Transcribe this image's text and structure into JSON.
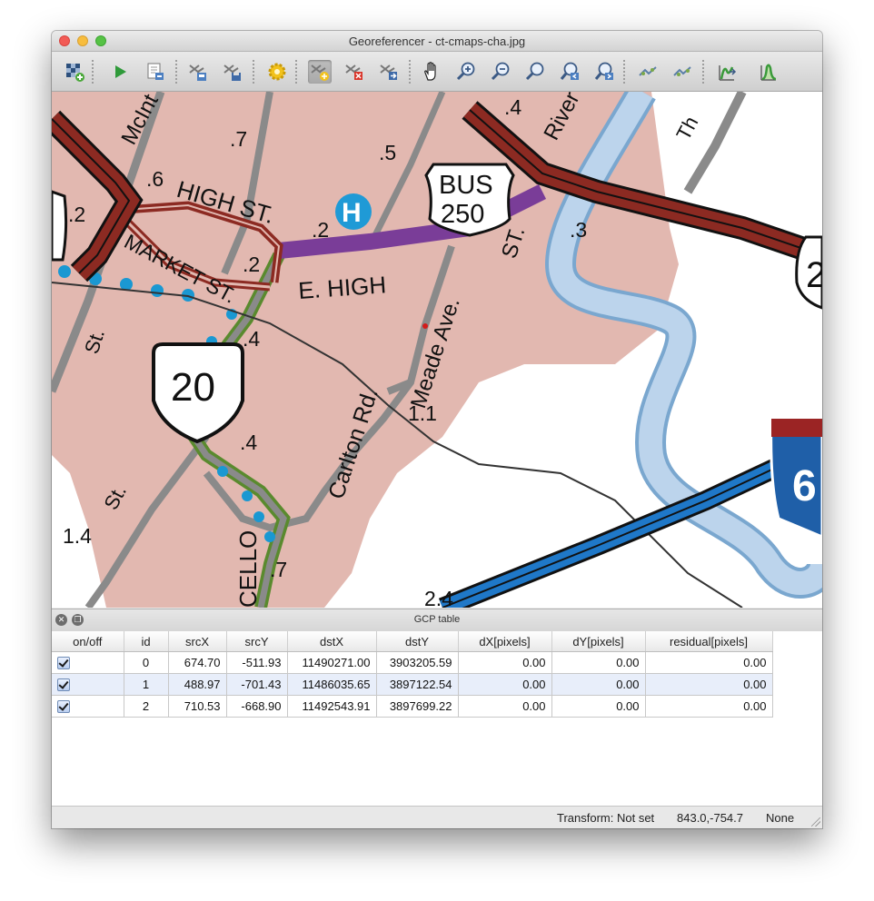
{
  "window": {
    "title": "Georeferencer - ct-cmaps-cha.jpg"
  },
  "toolbar": {
    "buttons": [
      {
        "icon": "open-raster-icon",
        "label": "Open raster"
      },
      {
        "icon": "start-georeferencing-icon",
        "label": "Start georeferencing"
      },
      {
        "icon": "generate-gdal-script-icon",
        "label": "Generate GDAL script"
      },
      {
        "icon": "load-gcp-points-icon",
        "label": "Load GCP points"
      },
      {
        "icon": "save-gcp-points-icon",
        "label": "Save GCP points"
      },
      {
        "icon": "transformation-settings-icon",
        "label": "Transformation settings"
      },
      {
        "icon": "add-point-icon",
        "label": "Add point"
      },
      {
        "icon": "delete-point-icon",
        "label": "Delete point"
      },
      {
        "icon": "move-gcp-point-icon",
        "label": "Move GCP point"
      },
      {
        "icon": "pan-icon",
        "label": "Pan"
      },
      {
        "icon": "zoom-in-icon",
        "label": "Zoom in"
      },
      {
        "icon": "zoom-out-icon",
        "label": "Zoom out"
      },
      {
        "icon": "zoom-to-layer-icon",
        "label": "Zoom to layer"
      },
      {
        "icon": "zoom-last-icon",
        "label": "Zoom last"
      },
      {
        "icon": "zoom-next-icon",
        "label": "Zoom next"
      },
      {
        "icon": "link-georeferencer-to-qgis-icon",
        "label": "Link georeferencer to QGIS"
      },
      {
        "icon": "link-qgis-to-georeferencer-icon",
        "label": "Link QGIS to georeferencer"
      },
      {
        "icon": "full-histogram-stretch-icon",
        "label": "Full histogram stretch"
      },
      {
        "icon": "local-histogram-stretch-icon",
        "label": "Local histogram stretch"
      }
    ]
  },
  "map": {
    "labels": {
      "high_st_top": "HIGH ST.",
      "market_st": "MARKET ST.",
      "e_high": "E.   HIGH",
      "meade_ave": "Meade Ave.",
      "carlton_rd": "Carlton Rd.",
      "river": "River",
      "mcint": "McInt",
      "st_left": "St.",
      "st_lower": "St.",
      "st_meade": "ST.",
      "cello": "CELLO",
      "th": "Th"
    },
    "mile_markers": [
      ".6",
      ".7",
      ".5",
      ".4",
      ".2",
      ".2",
      ".4",
      ".3",
      "1.1",
      ".4",
      "1.4",
      ".7",
      "2.4",
      ".2"
    ],
    "shields": {
      "bus_top": "BUS",
      "bus_bottom": "250",
      "route": "20",
      "interstate": "6",
      "partial_right": "2",
      "hospital": "H"
    },
    "colors": {
      "town": "#e2b8b0",
      "river": "#bcd4ec",
      "highway": "#8c2a22",
      "business": "#7a3d98",
      "road": "#8a8a8a",
      "interstate": "#1f78c8",
      "hospital": "#1f9ad6",
      "green_route": "#5a8a2e",
      "bike_dots": "#1a98d2"
    }
  },
  "dock": {
    "title": "GCP table"
  },
  "gcp_table": {
    "columns": [
      "on/off",
      "id",
      "srcX",
      "srcY",
      "dstX",
      "dstY",
      "dX[pixels]",
      "dY[pixels]",
      "residual[pixels]"
    ],
    "rows": [
      {
        "on": true,
        "id": "0",
        "srcX": "674.70",
        "srcY": "-511.93",
        "dstX": "11490271.00",
        "dstY": "3903205.59",
        "dX": "0.00",
        "dY": "0.00",
        "residual": "0.00"
      },
      {
        "on": true,
        "id": "1",
        "srcX": "488.97",
        "srcY": "-701.43",
        "dstX": "11486035.65",
        "dstY": "3897122.54",
        "dX": "0.00",
        "dY": "0.00",
        "residual": "0.00"
      },
      {
        "on": true,
        "id": "2",
        "srcX": "710.53",
        "srcY": "-668.90",
        "dstX": "11492543.91",
        "dstY": "3897699.22",
        "dX": "0.00",
        "dY": "0.00",
        "residual": "0.00"
      }
    ]
  },
  "status": {
    "transform": "Transform: Not set",
    "coordinates": "843.0,-754.7",
    "crs": "None"
  }
}
